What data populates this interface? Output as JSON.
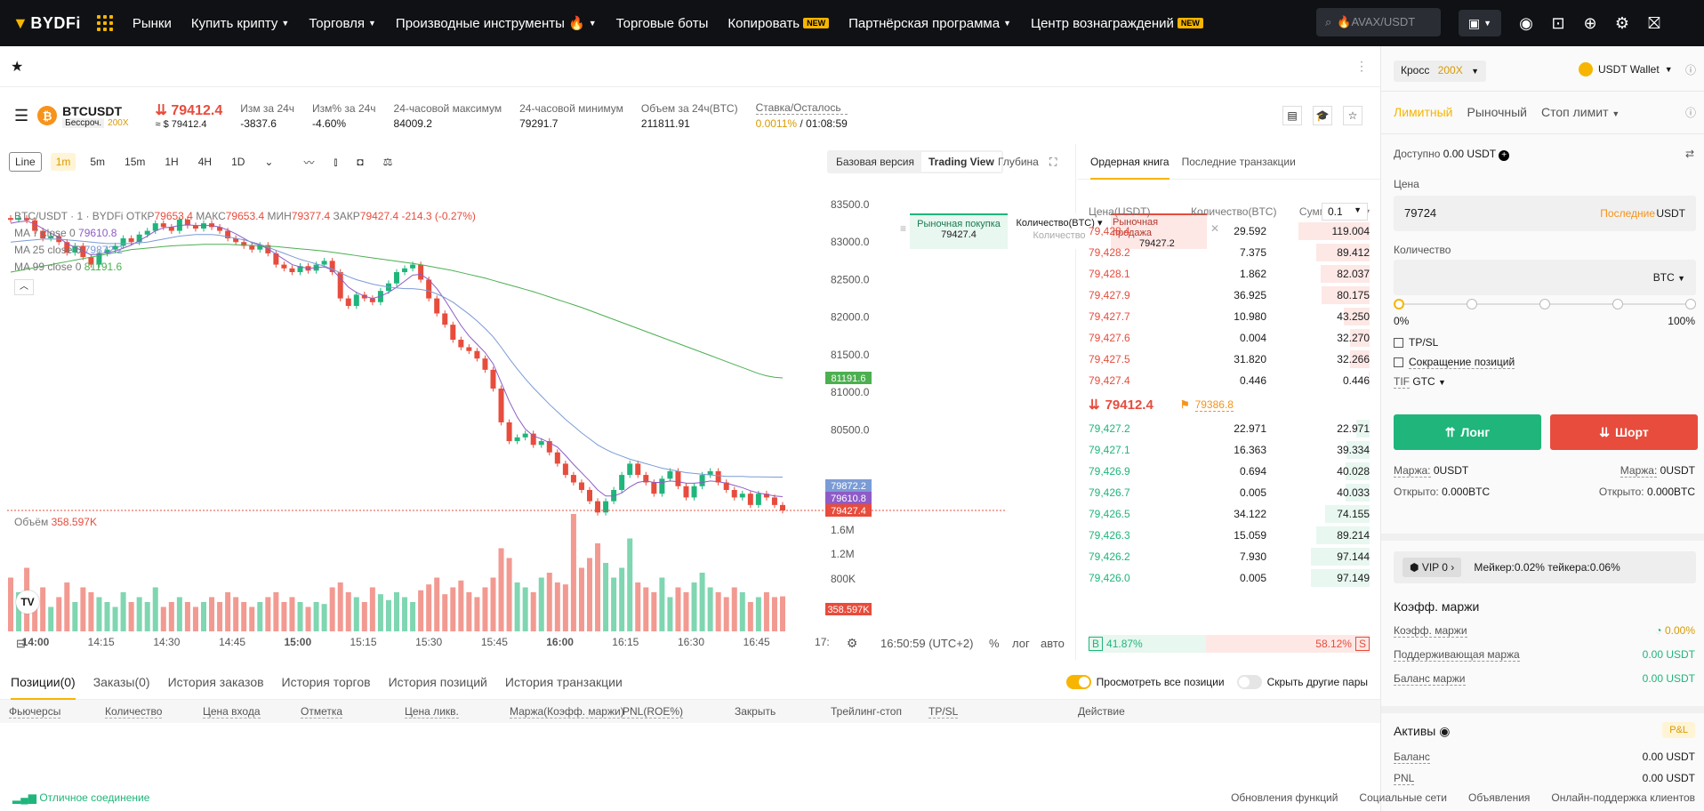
{
  "nav": {
    "logo": "BYDFi",
    "items": [
      {
        "label": "Рынки",
        "caret": false,
        "badge": ""
      },
      {
        "label": "Купить крипту",
        "caret": true,
        "badge": ""
      },
      {
        "label": "Торговля",
        "caret": true,
        "badge": ""
      },
      {
        "label": "Производные инструменты 🔥",
        "caret": true,
        "badge": ""
      },
      {
        "label": "Торговые боты",
        "caret": false,
        "badge": ""
      },
      {
        "label": "Копировать",
        "caret": false,
        "badge": "NEW"
      },
      {
        "label": "Партнёрская программа",
        "caret": true,
        "badge": ""
      },
      {
        "label": "Центр вознаграждений",
        "caret": false,
        "badge": "NEW"
      }
    ],
    "search_placeholder": "🔥AVAX/USDT"
  },
  "ticker": {
    "symbol": "BTCUSDT",
    "subtype": "Бессроч.",
    "leverage": "200X",
    "price": "79412.4",
    "price_usd": "≈ $ 79412.4",
    "stats": [
      {
        "label": "Изм за 24ч",
        "value": "-3837.6",
        "color": "red"
      },
      {
        "label": "Изм% за 24ч",
        "value": "-4.60%",
        "color": "red"
      },
      {
        "label": "24-часовой максимум",
        "value": "84009.2",
        "color": ""
      },
      {
        "label": "24-часовой минимум",
        "value": "79291.7",
        "color": ""
      },
      {
        "label": "Объем за 24ч(BTC)",
        "value": "211811.91",
        "color": ""
      }
    ],
    "funding_label": "Ставка/Осталось",
    "funding_rate": "0.0011%",
    "funding_time": "/ 01:08:59"
  },
  "chart_toolbar": {
    "type_label": "Line",
    "timeframes": [
      "1m",
      "5m",
      "15m",
      "1H",
      "4H",
      "1D"
    ],
    "active_tf": "1m",
    "basic": "Базовая версия",
    "tradingview": "Trading View",
    "depth": "Глубина"
  },
  "chart_legend": {
    "symbol": "BTC/USDT · 1 · BYDFi",
    "open_label": "ОТКР",
    "open": "79653.4",
    "high_label": "МАКС",
    "high": "79653.4",
    "low_label": "МИН",
    "low": "79377.4",
    "close_label": "ЗАКР",
    "close": "79427.4",
    "change": "-214.3 (-0.27%)",
    "ma7": "MA 7 close 0",
    "ma7_val": "79610.8",
    "ma25": "MA 25 close 0",
    "ma25_val": "79872.2",
    "ma99": "MA 99 close 0",
    "ma99_val": "81191.6",
    "volume_label": "Объём",
    "volume_val": "358.597K"
  },
  "quick_order": {
    "buy_label": "Рыночная покупка",
    "buy_price": "79427.4",
    "qty_label": "Количество(BTC)",
    "qty_placeholder": "Количество",
    "sell_label": "Рыночная продажа",
    "sell_price": "79427.2"
  },
  "chart_data": {
    "type": "candlestick",
    "y_ticks": [
      "83500.0",
      "83000.0",
      "82500.0",
      "82000.0",
      "81500.0",
      "81000.0",
      "80500.0"
    ],
    "price_tags": [
      {
        "value": "81191.6",
        "color": "#4caf50"
      },
      {
        "value": "79872.2",
        "color": "#7b9bd6"
      },
      {
        "value": "79610.8",
        "color": "#8e5bc7"
      },
      {
        "value": "79427.4",
        "color": "#e74c3c"
      }
    ],
    "vol_ticks": [
      "1.6M",
      "1.2M",
      "800K"
    ],
    "vol_tag": "358.597K",
    "x_ticks": [
      "14:00",
      "14:15",
      "14:30",
      "14:45",
      "15:00",
      "15:15",
      "15:30",
      "15:45",
      "16:00",
      "16:15",
      "16:30",
      "16:45",
      "17:"
    ],
    "close": [
      83300,
      83320,
      83290,
      83150,
      83050,
      83080,
      83000,
      82860,
      82950,
      82800,
      82700,
      82850,
      82900,
      82950,
      83050,
      83000,
      83100,
      83150,
      83250,
      83200,
      83150,
      83300,
      83220,
      83180,
      83250,
      83200,
      83150,
      83050,
      83000,
      82950,
      82900,
      82960,
      82850,
      82700,
      82650,
      82600,
      82680,
      82620,
      82700,
      82750,
      82600,
      82250,
      82150,
      82300,
      82250,
      82200,
      82350,
      82450,
      82600,
      82650,
      82700,
      82500,
      82250,
      82050,
      81900,
      81700,
      81600,
      81550,
      81450,
      81300,
      81050,
      80600,
      80350,
      80400,
      80450,
      80300,
      80350,
      80200,
      80050,
      79900,
      79800,
      79700,
      79550,
      79400,
      79550,
      79700,
      79900,
      80050,
      79900,
      79800,
      79650,
      79850,
      79950,
      79750,
      79600,
      79750,
      79900,
      79950,
      79800,
      79700,
      79600,
      79650,
      79500,
      79650,
      79600,
      79500,
      79427
    ],
    "ma7": [
      83250,
      83270,
      83280,
      83240,
      83180,
      83120,
      83060,
      82980,
      82930,
      82880,
      82830,
      82840,
      82860,
      82880,
      82920,
      82960,
      83020,
      83080,
      83150,
      83190,
      83200,
      83220,
      83230,
      83220,
      83220,
      83220,
      83200,
      83160,
      83110,
      83050,
      82990,
      82960,
      82910,
      82840,
      82770,
      82700,
      82670,
      82650,
      82660,
      82670,
      82630,
      82520,
      82400,
      82330,
      82280,
      82250,
      82280,
      82330,
      82400,
      82480,
      82560,
      82570,
      82500,
      82380,
      82230,
      82060,
      81890,
      81750,
      81640,
      81530,
      81380,
      81130,
      80880,
      80670,
      80510,
      80420,
      80380,
      80330,
      80270,
      80160,
      80040,
      79930,
      79820,
      79700,
      79620,
      79620,
      79660,
      79740,
      79800,
      79820,
      79800,
      79800,
      79820,
      79810,
      79790,
      79790,
      79800,
      79820,
      79810,
      79790,
      79760,
      79730,
      79690,
      79660,
      79640,
      79620,
      79611
    ],
    "ma25": [
      83000,
      83010,
      83020,
      83030,
      83040,
      83040,
      83040,
      83030,
      83020,
      83010,
      83000,
      82990,
      82980,
      82980,
      82980,
      82980,
      82990,
      83000,
      83020,
      83040,
      83060,
      83080,
      83090,
      83100,
      83100,
      83100,
      83090,
      83070,
      83050,
      83030,
      83000,
      82970,
      82930,
      82890,
      82850,
      82810,
      82770,
      82740,
      82710,
      82680,
      82640,
      82590,
      82540,
      82500,
      82470,
      82440,
      82420,
      82400,
      82390,
      82380,
      82380,
      82370,
      82350,
      82310,
      82260,
      82200,
      82120,
      82040,
      81950,
      81850,
      81740,
      81600,
      81450,
      81310,
      81180,
      81060,
      80950,
      80840,
      80740,
      80640,
      80550,
      80460,
      80380,
      80300,
      80240,
      80190,
      80150,
      80110,
      80080,
      80050,
      80020,
      79990,
      79970,
      79950,
      79930,
      79920,
      79910,
      79900,
      79890,
      79880,
      79880,
      79880,
      79875,
      79875,
      79873,
      79872,
      79872
    ],
    "ma99": [
      82600,
      82620,
      82640,
      82660,
      82680,
      82700,
      82720,
      82740,
      82760,
      82780,
      82800,
      82820,
      82840,
      82860,
      82880,
      82900,
      82910,
      82920,
      82930,
      82940,
      82950,
      82955,
      82960,
      82965,
      82970,
      82970,
      82970,
      82970,
      82965,
      82960,
      82955,
      82950,
      82945,
      82940,
      82930,
      82920,
      82910,
      82900,
      82890,
      82880,
      82865,
      82850,
      82835,
      82820,
      82805,
      82790,
      82775,
      82760,
      82745,
      82730,
      82715,
      82700,
      82680,
      82660,
      82640,
      82620,
      82595,
      82570,
      82545,
      82520,
      82490,
      82460,
      82430,
      82400,
      82370,
      82340,
      82305,
      82270,
      82235,
      82200,
      82165,
      82130,
      82090,
      82050,
      82010,
      81970,
      81930,
      81890,
      81850,
      81810,
      81770,
      81730,
      81690,
      81650,
      81610,
      81570,
      81530,
      81490,
      81450,
      81410,
      81370,
      81330,
      81290,
      81250,
      81220,
      81200,
      81192
    ],
    "volume": [
      0.55,
      0.4,
      0.65,
      0.3,
      0.45,
      0.25,
      0.35,
      0.5,
      0.3,
      0.45,
      0.4,
      0.35,
      0.3,
      0.25,
      0.4,
      0.3,
      0.35,
      0.3,
      0.45,
      0.25,
      0.3,
      0.35,
      0.3,
      0.25,
      0.3,
      0.35,
      0.3,
      0.4,
      0.35,
      0.3,
      0.25,
      0.3,
      0.35,
      0.4,
      0.3,
      0.35,
      0.3,
      0.25,
      0.3,
      0.28,
      0.45,
      0.5,
      0.4,
      0.35,
      0.3,
      0.45,
      0.38,
      0.32,
      0.4,
      0.35,
      0.3,
      0.42,
      0.48,
      0.55,
      0.38,
      0.45,
      0.52,
      0.4,
      0.35,
      0.45,
      0.55,
      0.85,
      0.75,
      0.5,
      0.45,
      0.4,
      0.55,
      0.6,
      0.5,
      0.48,
      1.2,
      0.65,
      0.75,
      0.9,
      0.7,
      0.55,
      0.65,
      0.95,
      0.5,
      0.45,
      0.4,
      0.55,
      0.35,
      0.45,
      0.4,
      0.5,
      0.6,
      0.45,
      0.4,
      0.35,
      0.45,
      0.4,
      0.3,
      0.35,
      0.4,
      0.35,
      0.358
    ],
    "ylim": [
      80000,
      83500
    ]
  },
  "orderbook": {
    "tabs": [
      "Ордерная книга",
      "Последние транзакции"
    ],
    "step": "0.1",
    "head": [
      "Цена(USDT)",
      "Количество(BTC)",
      "Сумма(BTC)"
    ],
    "asks": [
      {
        "p": "79,428.4",
        "q": "29.592",
        "s": "119.004",
        "w": 1.0
      },
      {
        "p": "79,428.2",
        "q": "7.375",
        "s": "89.412",
        "w": 0.75
      },
      {
        "p": "79,428.1",
        "q": "1.862",
        "s": "82.037",
        "w": 0.69
      },
      {
        "p": "79,427.9",
        "q": "36.925",
        "s": "80.175",
        "w": 0.67
      },
      {
        "p": "79,427.7",
        "q": "10.980",
        "s": "43.250",
        "w": 0.36
      },
      {
        "p": "79,427.6",
        "q": "0.004",
        "s": "32.270",
        "w": 0.27
      },
      {
        "p": "79,427.5",
        "q": "31.820",
        "s": "32.266",
        "w": 0.27
      },
      {
        "p": "79,427.4",
        "q": "0.446",
        "s": "0.446",
        "w": 0.01
      }
    ],
    "mid_price": "79412.4",
    "mark_price": "79386.8",
    "bids": [
      {
        "p": "79,427.2",
        "q": "22.971",
        "s": "22.971",
        "w": 0.19
      },
      {
        "p": "79,427.1",
        "q": "16.363",
        "s": "39.334",
        "w": 0.33
      },
      {
        "p": "79,426.9",
        "q": "0.694",
        "s": "40.028",
        "w": 0.34
      },
      {
        "p": "79,426.7",
        "q": "0.005",
        "s": "40.033",
        "w": 0.34
      },
      {
        "p": "79,426.5",
        "q": "34.122",
        "s": "74.155",
        "w": 0.62
      },
      {
        "p": "79,426.3",
        "q": "15.059",
        "s": "89.214",
        "w": 0.75
      },
      {
        "p": "79,426.2",
        "q": "7.930",
        "s": "97.144",
        "w": 0.82
      },
      {
        "p": "79,426.0",
        "q": "0.005",
        "s": "97.149",
        "w": 0.82
      }
    ],
    "buy_ratio": "41.87%",
    "sell_ratio": "58.12%",
    "buy_pct": 41.87
  },
  "chart_footer": {
    "time": "16:50:59 (UTC+2)",
    "pct": "%",
    "log": "лог",
    "auto": "авто"
  },
  "bottom": {
    "tabs": [
      "Позиции(0)",
      "Заказы(0)",
      "История заказов",
      "История торгов",
      "История позиций",
      "История транзакции"
    ],
    "view_all": "Просмотреть все позиции",
    "hide_other": "Скрыть другие пары",
    "cols": [
      "Фьючерсы",
      "Количество",
      "Цена входа",
      "Отметка",
      "Цена ликв.",
      "Маржа(Коэфф. маржи)",
      "PNL(ROE%)",
      "Закрыть",
      "Трейлинг-стоп",
      "TP/SL",
      "Действие"
    ]
  },
  "status": {
    "connection": "Отличное соединение",
    "links": [
      "Обновления функций",
      "Социальные сети",
      "Объявления",
      "Онлайн-поддержка клиентов"
    ]
  },
  "panel": {
    "margin_mode": "Кросс",
    "leverage": "200X",
    "wallet": "USDT Wallet",
    "order_types": [
      "Лимитный",
      "Рыночный",
      "Стоп лимит"
    ],
    "available_label": "Доступно",
    "available": "0.00 USDT",
    "price_label": "Цена",
    "price_value": "79724",
    "last_label": "Последние",
    "price_unit": "USDT",
    "qty_label": "Количество",
    "qty_unit": "BTC",
    "slider_min": "0%",
    "slider_max": "100%",
    "slider_value": 0,
    "tpsl": "TP/SL",
    "reduce": "Сокращение позиций",
    "tif_label": "TIF",
    "tif_value": "GTC",
    "long": "Лонг",
    "short": "Шорт",
    "margin_label": "Маржа:",
    "margin_long": "0USDT",
    "margin_short": "0USDT",
    "open_label": "Открыто:",
    "open_long": "0.000BTC",
    "open_short": "0.000BTC",
    "vip": "VIP 0",
    "fees": "Мейкер:0.02% тейкера:0.06%",
    "margin_ratio_title": "Коэфф. маржи",
    "margin_ratio_label": "Коэфф. маржи",
    "margin_ratio": "0.00%",
    "maint_label": "Поддерживающая маржа",
    "maint": "0.00 USDT",
    "balance_margin_label": "Баланс маржи",
    "balance_margin": "0.00 USDT",
    "assets_title": "Активы",
    "pnl_badge": "P&L",
    "balance_label": "Баланс",
    "balance": "0.00 USDT",
    "pnl_label": "PNL",
    "pnl": "0.00 USDT"
  }
}
